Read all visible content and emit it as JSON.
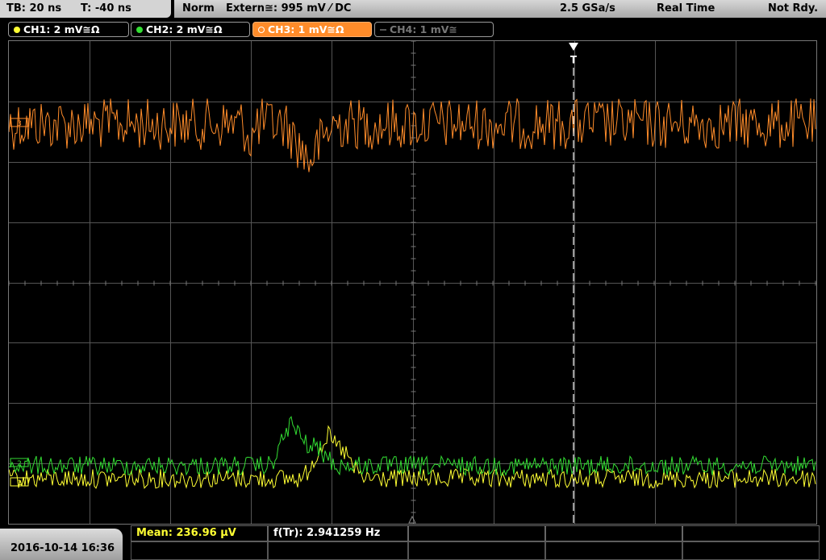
{
  "header": {
    "timebase": "TB: 20 ns",
    "trigger_time": "T: -40 ns",
    "trigger_mode": "Norm",
    "trigger_source": "Extern≅: 995 mV ⁄ DC",
    "sample_rate": "2.5 GSa/s",
    "acq_mode": "Real Time",
    "status": "Not Rdy."
  },
  "channels": [
    {
      "label": "CH1: 2 mV≅Ω",
      "color": "#ffff33",
      "active": true
    },
    {
      "label": "CH2: 2 mV≅Ω",
      "color": "#33dd33",
      "active": true
    },
    {
      "label": "CH3: 1 mV≅Ω",
      "color": "#ff8c2a",
      "active": true,
      "selected": true
    },
    {
      "label": "CH4: 1 mV≅",
      "color": "#888888",
      "active": false
    }
  ],
  "markers": {
    "trigger": "T",
    "ch1": "1",
    "ch2": "2",
    "ch3": "3"
  },
  "measurements": {
    "mean": "Mean: 236.96 µV",
    "freq": "f(Tr): 2.941259 Hz"
  },
  "footer": {
    "datetime": "2016-10-14 16:36"
  },
  "colors": {
    "ch1": "#ffff33",
    "ch2": "#33dd33",
    "ch3": "#ff8c2a",
    "grid": "#555555"
  }
}
